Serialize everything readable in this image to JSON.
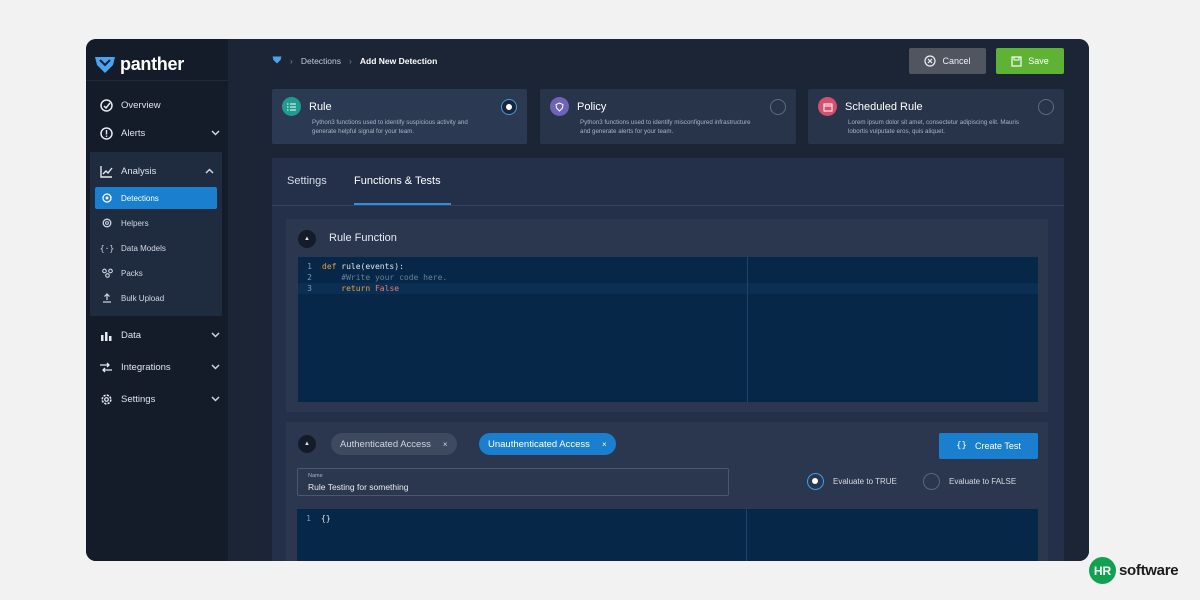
{
  "app": {
    "logo_text": "panther"
  },
  "sidebar": {
    "items": [
      {
        "label": "Overview",
        "icon": "overview-icon"
      },
      {
        "label": "Alerts",
        "icon": "alert-icon"
      },
      {
        "label": "Analysis",
        "icon": "analysis-icon"
      },
      {
        "label": "Data",
        "icon": "data-icon"
      },
      {
        "label": "Integrations",
        "icon": "integrations-icon"
      },
      {
        "label": "Settings",
        "icon": "gear-icon"
      }
    ],
    "sub_items": [
      {
        "label": "Detections",
        "icon": "detections-icon"
      },
      {
        "label": "Helpers",
        "icon": "helpers-icon"
      },
      {
        "label": "Data Models",
        "icon": "data-models-icon"
      },
      {
        "label": "Packs",
        "icon": "packs-icon"
      },
      {
        "label": "Bulk Upload",
        "icon": "upload-icon"
      }
    ]
  },
  "header": {
    "breadcrumb": [
      "Detections",
      "Add New Detection"
    ],
    "cancel_label": "Cancel",
    "save_label": "Save"
  },
  "detection_types": [
    {
      "title": "Rule",
      "desc": "Python3 functions used to identify suspicious activity and generate helpful signal for your team.",
      "color": "#1f9b8f",
      "selected": true
    },
    {
      "title": "Policy",
      "desc": "Python3 functions used to identify misconfigured infrastructure and generate alerts for your team.",
      "color": "#6e63b8",
      "selected": false
    },
    {
      "title": "Scheduled Rule",
      "desc": "Lorem ipsum dolor sit amet, consectetur adipiscing elit. Mauris lobortis vulputate eros, quis aliquet.",
      "color": "#d4506e",
      "selected": false
    }
  ],
  "tabs": [
    "Settings",
    "Functions & Tests"
  ],
  "rule_function": {
    "title": "Rule Function",
    "code": {
      "line1_kw": "def",
      "line1_rest": " rule(events):",
      "line2": "    #Write your code here.",
      "line3_kw": "    return",
      "line3_val": " False"
    },
    "line_numbers": [
      "1",
      "2",
      "3"
    ]
  },
  "tests": {
    "chips": [
      "Authenticated Access",
      "Unauthenticated Access"
    ],
    "chip_close": "×",
    "create_label": "Create Test",
    "name_label": "Name",
    "name_value": "Rule Testing for something",
    "eval_true": "Evaluate to TRUE",
    "eval_false": "Evaluate to FALSE",
    "test_code_line": "{}",
    "test_line_number": "1"
  },
  "watermark": {
    "badge": "HR",
    "text": "software"
  },
  "colors": {
    "accent": "#1a7fce",
    "save": "#5fb334",
    "cancel": "#515560"
  }
}
